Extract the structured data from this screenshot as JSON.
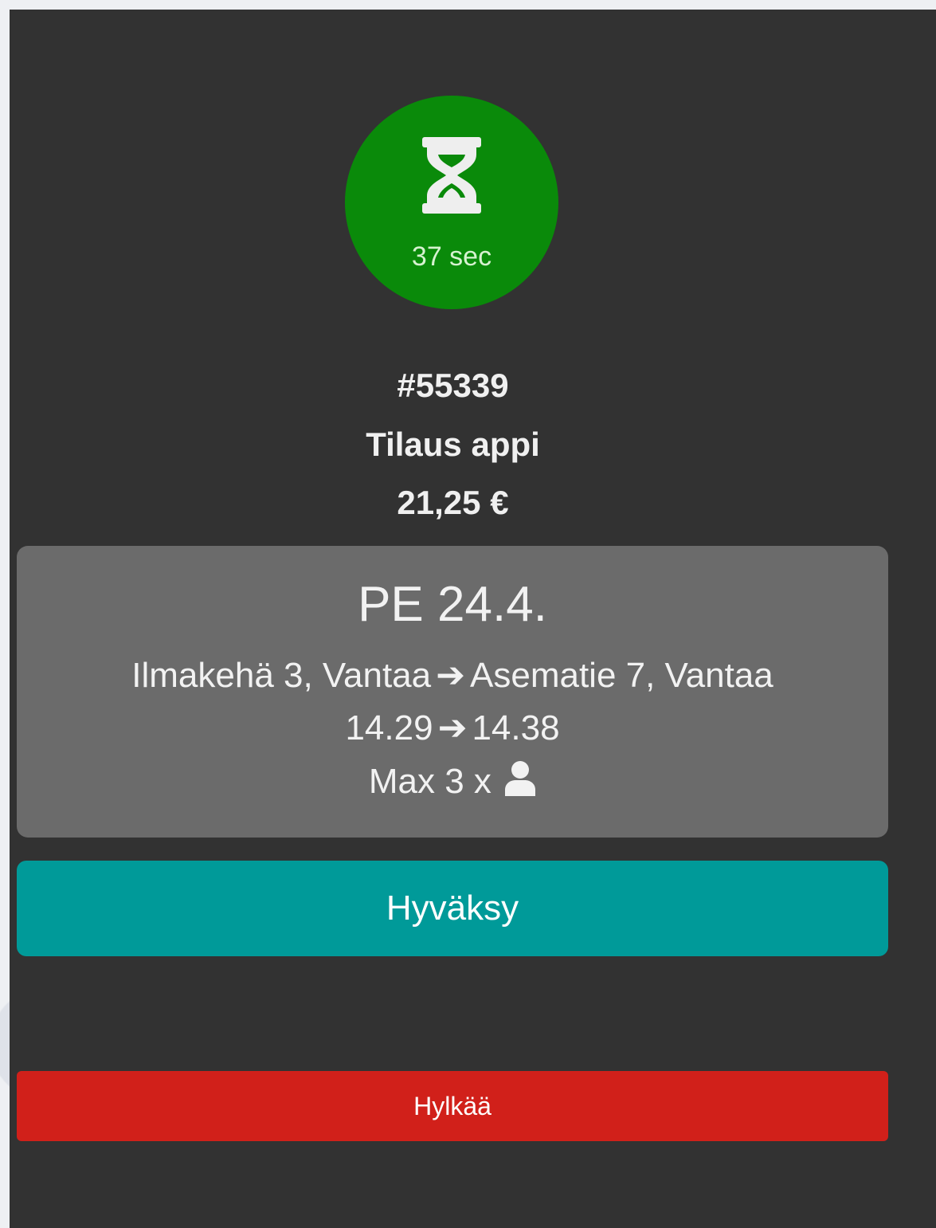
{
  "timer": {
    "icon": "hourglass-icon",
    "text": "37 sec",
    "color": "#0a8a0a"
  },
  "order": {
    "id": "#55339",
    "source": "Tilaus appi",
    "price": "21,25 €"
  },
  "details": {
    "date": "PE 24.4.",
    "from_address": "Ilmakehä 3, Vantaa",
    "to_address": "Asematie 7, Vantaa",
    "start_time": "14.29",
    "end_time": "14.38",
    "capacity_text": "Max 3 x",
    "capacity_icon": "person-icon",
    "arrow_icon": "arrow-right-icon"
  },
  "actions": {
    "accept_label": "Hyväksy",
    "accept_color": "#009a99",
    "reject_label": "Hylkää",
    "reject_color": "#d1201a"
  }
}
